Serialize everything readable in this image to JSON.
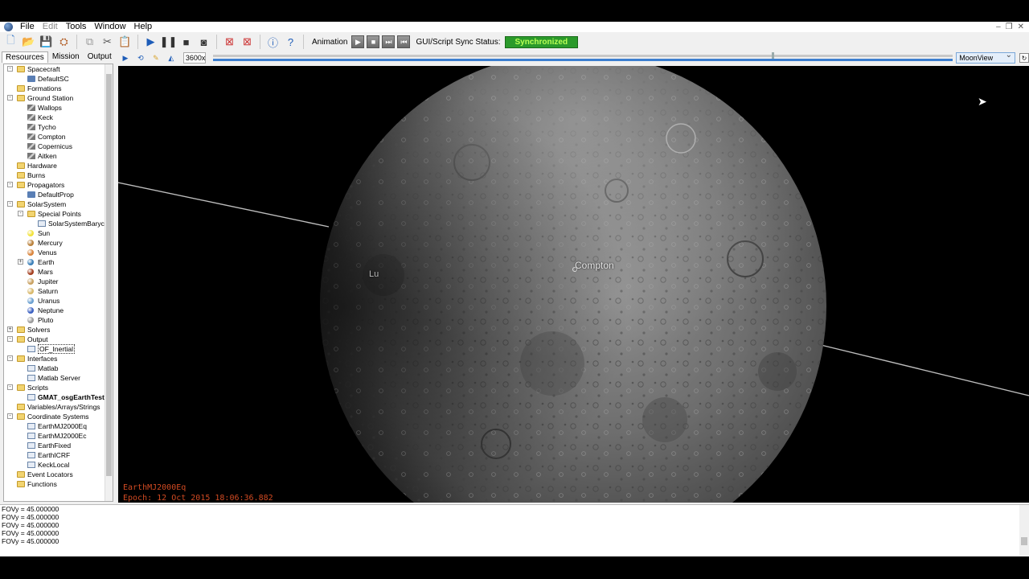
{
  "menu": {
    "items": [
      {
        "label": "File",
        "enabled": true
      },
      {
        "label": "Edit",
        "enabled": false
      },
      {
        "label": "Tools",
        "enabled": true
      },
      {
        "label": "Window",
        "enabled": true
      },
      {
        "label": "Help",
        "enabled": true
      }
    ]
  },
  "toolbar": {
    "animation_label": "Animation",
    "sync_label": "GUI/Script Sync Status:",
    "sync_status": "Synchronized",
    "sync_color": "#2b9a2b"
  },
  "tabs": [
    {
      "label": "Resources",
      "active": true
    },
    {
      "label": "Mission",
      "active": false
    },
    {
      "label": "Output",
      "active": false
    }
  ],
  "view_toolbar": {
    "speed_value": "3600x",
    "progress_fraction": 0.0,
    "view_selected": "MoonView"
  },
  "tree": [
    {
      "label": "Spacecraft",
      "depth": 0,
      "icon": "folder",
      "expand": "-"
    },
    {
      "label": "DefaultSC",
      "depth": 1,
      "icon": "spacecraft"
    },
    {
      "label": "Formations",
      "depth": 0,
      "icon": "folder"
    },
    {
      "label": "Ground Station",
      "depth": 0,
      "icon": "folder",
      "expand": "-"
    },
    {
      "label": "Wallops",
      "depth": 1,
      "icon": "groundstation"
    },
    {
      "label": "Keck",
      "depth": 1,
      "icon": "groundstation"
    },
    {
      "label": "Tycho",
      "depth": 1,
      "icon": "groundstation"
    },
    {
      "label": "Compton",
      "depth": 1,
      "icon": "groundstation"
    },
    {
      "label": "Copernicus",
      "depth": 1,
      "icon": "groundstation"
    },
    {
      "label": "Aitken",
      "depth": 1,
      "icon": "groundstation"
    },
    {
      "label": "Hardware",
      "depth": 0,
      "icon": "folder"
    },
    {
      "label": "Burns",
      "depth": 0,
      "icon": "folder"
    },
    {
      "label": "Propagators",
      "depth": 0,
      "icon": "folder",
      "expand": "-"
    },
    {
      "label": "DefaultProp",
      "depth": 1,
      "icon": "propagator"
    },
    {
      "label": "SolarSystem",
      "depth": 0,
      "icon": "folder",
      "expand": "-"
    },
    {
      "label": "Special Points",
      "depth": 1,
      "icon": "folder",
      "expand": "-"
    },
    {
      "label": "SolarSystemBarycen",
      "depth": 2,
      "icon": "barycenter"
    },
    {
      "label": "Sun",
      "depth": 1,
      "icon": "sun"
    },
    {
      "label": "Mercury",
      "depth": 1,
      "icon": "mercury"
    },
    {
      "label": "Venus",
      "depth": 1,
      "icon": "venus"
    },
    {
      "label": "Earth",
      "depth": 1,
      "icon": "earth",
      "expand": "+"
    },
    {
      "label": "Mars",
      "depth": 1,
      "icon": "mars"
    },
    {
      "label": "Jupiter",
      "depth": 1,
      "icon": "jupiter"
    },
    {
      "label": "Saturn",
      "depth": 1,
      "icon": "saturn"
    },
    {
      "label": "Uranus",
      "depth": 1,
      "icon": "uranus"
    },
    {
      "label": "Neptune",
      "depth": 1,
      "icon": "neptune"
    },
    {
      "label": "Pluto",
      "depth": 1,
      "icon": "pluto"
    },
    {
      "label": "Solvers",
      "depth": 0,
      "icon": "folder",
      "expand": "+"
    },
    {
      "label": "Output",
      "depth": 0,
      "icon": "folder",
      "expand": "-"
    },
    {
      "label": "OF_Inertial",
      "depth": 1,
      "icon": "orbitview",
      "selected": true
    },
    {
      "label": "Interfaces",
      "depth": 0,
      "icon": "folder",
      "expand": "-"
    },
    {
      "label": "Matlab",
      "depth": 1,
      "icon": "interface"
    },
    {
      "label": "Matlab Server",
      "depth": 1,
      "icon": "interface"
    },
    {
      "label": "Scripts",
      "depth": 0,
      "icon": "folder",
      "expand": "-"
    },
    {
      "label": "GMAT_osgEarthTest.sc",
      "depth": 1,
      "icon": "script",
      "bold": true
    },
    {
      "label": "Variables/Arrays/Strings",
      "depth": 0,
      "icon": "folder"
    },
    {
      "label": "Coordinate Systems",
      "depth": 0,
      "icon": "folder",
      "expand": "-"
    },
    {
      "label": "EarthMJ2000Eq",
      "depth": 1,
      "icon": "coordsys"
    },
    {
      "label": "EarthMJ2000Ec",
      "depth": 1,
      "icon": "coordsys"
    },
    {
      "label": "EarthFixed",
      "depth": 1,
      "icon": "coordsys"
    },
    {
      "label": "EarthICRF",
      "depth": 1,
      "icon": "coordsys"
    },
    {
      "label": "KeckLocal",
      "depth": 1,
      "icon": "coordsys"
    },
    {
      "label": "Event Locators",
      "depth": 0,
      "icon": "folder"
    },
    {
      "label": "Functions",
      "depth": 0,
      "icon": "folder"
    }
  ],
  "view3d": {
    "coordinate_system": "EarthMJ2000Eq",
    "epoch": "Epoch: 12 Oct 2015 18:06:36.882",
    "ground_station_label": "Compton",
    "partial_label": "Lu"
  },
  "output_lines": [
    "FOVy = 45.000000",
    "FOVy = 45.000000",
    "FOVy = 45.000000",
    "FOVy = 45.000000",
    "FOVy = 45.000000"
  ]
}
